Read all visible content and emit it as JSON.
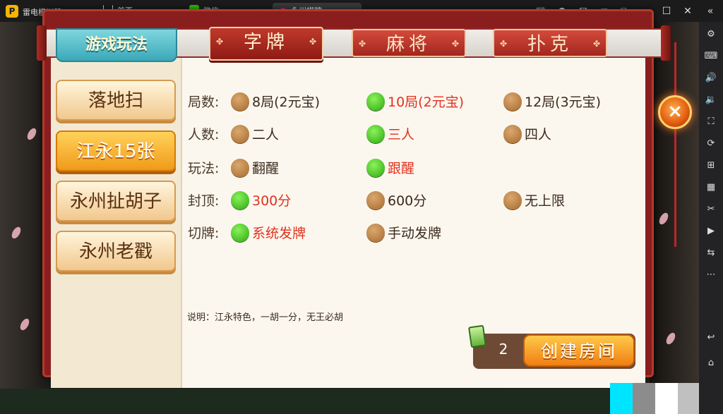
{
  "emulator": {
    "app_name": "雷电模拟器",
    "tabs": [
      {
        "label": "首页"
      },
      {
        "label": "微信"
      },
      {
        "label": "永州棋牌"
      }
    ],
    "tab_close": "×"
  },
  "game": {
    "play_tab": "游戏玩法",
    "categories": [
      "字牌",
      "麻将",
      "扑克"
    ],
    "modes": [
      "落地扫",
      "江永15张",
      "永州扯胡子",
      "永州老戳"
    ],
    "option_labels": [
      "局数:",
      "人数:",
      "玩法:",
      "封顶:",
      "切牌:"
    ],
    "rounds": [
      "8局(2元宝)",
      "10局(2元宝)",
      "12局(3元宝)"
    ],
    "players": [
      "二人",
      "三人",
      "四人"
    ],
    "play": [
      "翻醒",
      "跟醒"
    ],
    "cap": [
      "300分",
      "600分",
      "无上限"
    ],
    "deal": [
      "系统发牌",
      "手动发牌"
    ],
    "note": "说明：江永特色，一胡一分，无王必胡",
    "create_count": "2",
    "create_label": "创建房间",
    "close_symbol": "×"
  },
  "colors": {
    "selected_text": "#e0321e",
    "selected_dot": "#2ca810",
    "frame": "#8a1e1e",
    "accent_orange": "#f09a1a"
  }
}
